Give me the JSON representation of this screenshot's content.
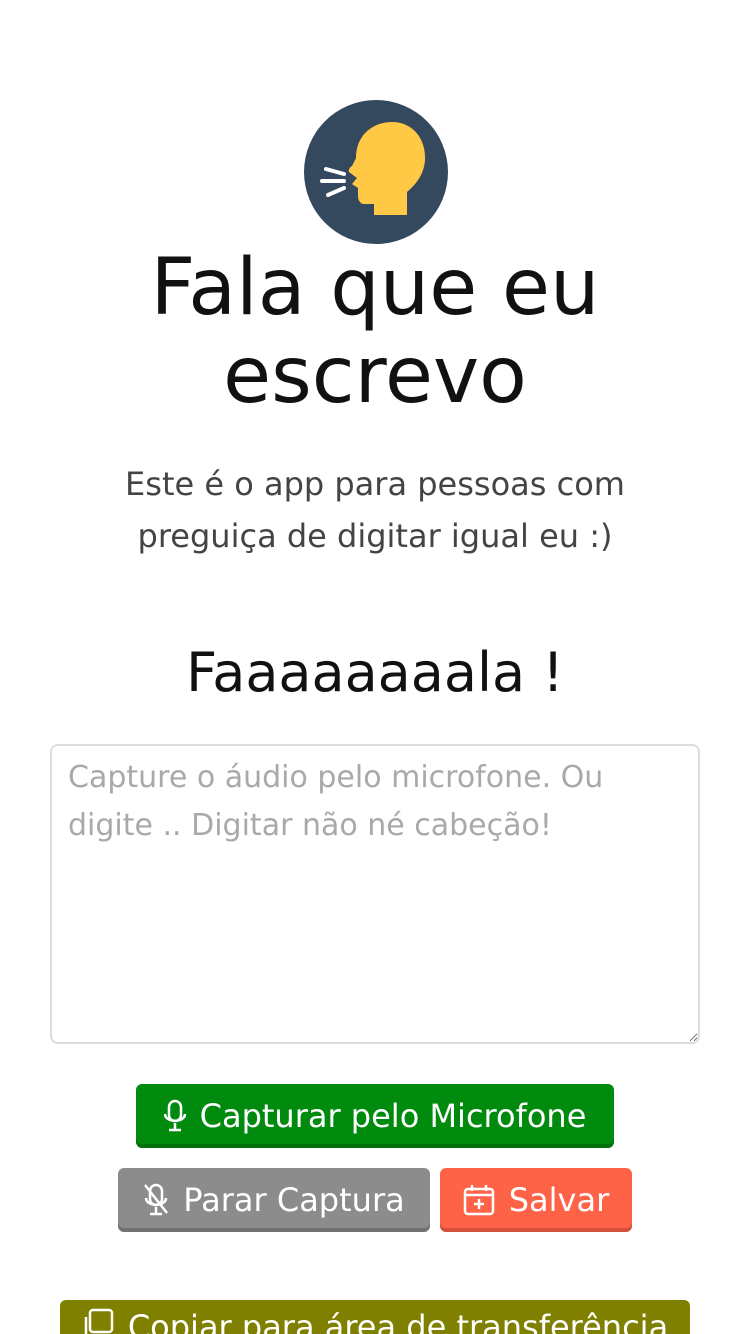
{
  "app": {
    "title": "Fala que eu escrevo",
    "subtitle": "Este é o app para pessoas com preguiça de digitar igual eu :)",
    "logo_icon": "speaking-head-icon"
  },
  "main": {
    "heading": "Faaaaaaaala !",
    "textarea": {
      "placeholder": "Capture o áudio pelo microfone. Ou digite .. Digitar não né cabeção!",
      "value": ""
    }
  },
  "actions": {
    "capture_label": "Capturar pelo Microfone",
    "capture_icon": "microphone-icon",
    "stop_label": "Parar Captura",
    "stop_icon": "microphone-slash-icon",
    "save_label": "Salvar",
    "save_icon": "calendar-plus-icon",
    "copy_label": "Copiar para área de transferência",
    "copy_icon": "copy-icon"
  },
  "colors": {
    "capture": "#008a0e",
    "stop": "#8c8c8c",
    "save": "#ff6347",
    "copy": "#808000",
    "logo_bg": "#34495e",
    "logo_head": "#ffc845"
  }
}
